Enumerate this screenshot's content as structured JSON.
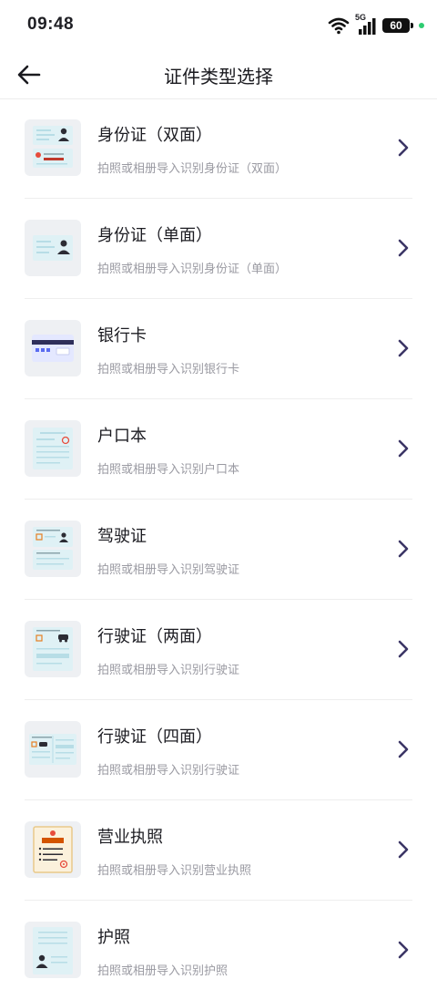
{
  "status_bar": {
    "time": "09:48",
    "network": "5G",
    "battery": "60"
  },
  "header": {
    "title": "证件类型选择"
  },
  "items": [
    {
      "title": "身份证（双面）",
      "subtitle": "拍照或相册导入识别身份证（双面）",
      "icon": "id-card-double-icon"
    },
    {
      "title": "身份证（单面）",
      "subtitle": "拍照或相册导入识别身份证（单面）",
      "icon": "id-card-single-icon"
    },
    {
      "title": "银行卡",
      "subtitle": "拍照或相册导入识别银行卡",
      "icon": "bank-card-icon"
    },
    {
      "title": "户口本",
      "subtitle": "拍照或相册导入识别户口本",
      "icon": "household-register-icon"
    },
    {
      "title": "驾驶证",
      "subtitle": "拍照或相册导入识别驾驶证",
      "icon": "driver-license-icon"
    },
    {
      "title": "行驶证（两面）",
      "subtitle": "拍照或相册导入识别行驶证",
      "icon": "vehicle-license-two-icon"
    },
    {
      "title": "行驶证（四面）",
      "subtitle": "拍照或相册导入识别行驶证",
      "icon": "vehicle-license-four-icon"
    },
    {
      "title": "营业执照",
      "subtitle": "拍照或相册导入识别营业执照",
      "icon": "business-license-icon"
    },
    {
      "title": "护照",
      "subtitle": "拍照或相册导入识别护照",
      "icon": "passport-icon"
    }
  ],
  "colors": {
    "accent": "#3b3565",
    "subtitle": "#9a9aa2",
    "thumb_bg": "#eef0f3",
    "status_dot": "#2ecc71"
  }
}
